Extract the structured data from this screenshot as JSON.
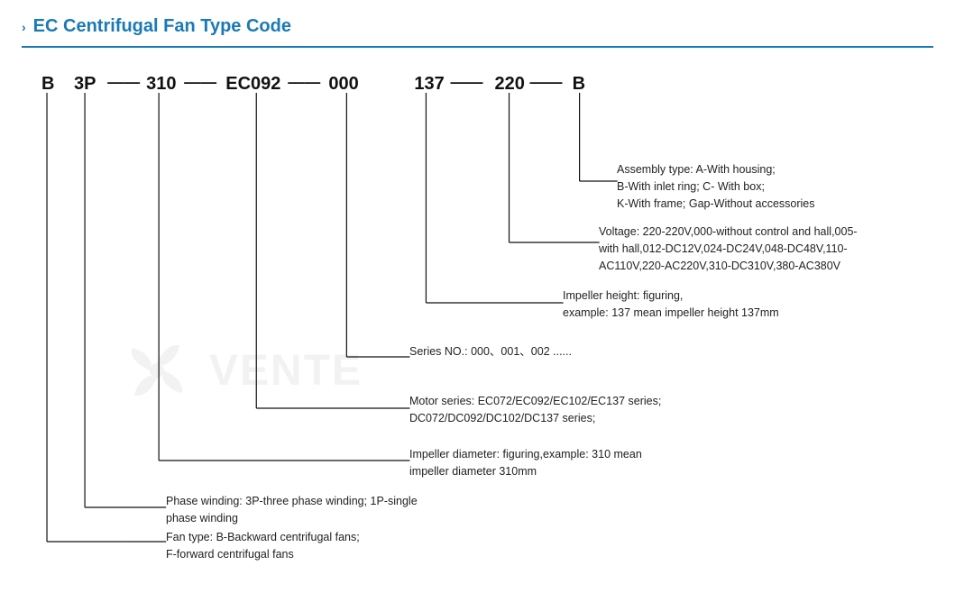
{
  "title": "EC Centrifugal Fan Type Code",
  "chevron": "›",
  "typeCode": {
    "segments": [
      "B",
      "3P",
      "310",
      "EC092",
      "000",
      "137",
      "220",
      "B"
    ],
    "dashes": [
      "—",
      "—",
      "—",
      "—",
      "—",
      "—",
      "—"
    ]
  },
  "annotations": {
    "assemblyType": {
      "label": "Assembly type:",
      "text": "A-With housing;\nB-With inlet ring;  C- With box;\nK-With frame; Gap-Without accessories"
    },
    "voltage": {
      "label": "Voltage:",
      "text": "220-220V,000-without control and hall,005-with hall,012-DC12V,024-DC24V,048-DC48V,110-AC110V,220-AC220V,310-DC310V,380-AC380V"
    },
    "impellerHeight": {
      "label": "Impeller height:",
      "text": "figuring,\nexample: 137 mean impeller height 137mm"
    },
    "seriesNo": {
      "label": "Series NO.:",
      "text": "000、001、002 ......"
    },
    "motorSeries": {
      "label": "Motor series:",
      "text": "EC072/EC092/EC102/EC137 series;\nDC072/DC092/DC102/DC137 series;"
    },
    "impellerDiameter": {
      "label": "Impeller diameter:",
      "text": "figuring,example: 310 mean\nimpeller diameter 310mm"
    },
    "phaseWinding": {
      "label": "Phase winding:",
      "text": "3P-three phase winding;  1P-single\nphase winding"
    },
    "fanType": {
      "label": "Fan type:",
      "text": "B-Backward centrifugal fans;\nF-forward centrifugal fans"
    }
  },
  "watermarkText": "VENTE",
  "colors": {
    "accent": "#1a7ab5",
    "text": "#222",
    "line": "#222"
  }
}
